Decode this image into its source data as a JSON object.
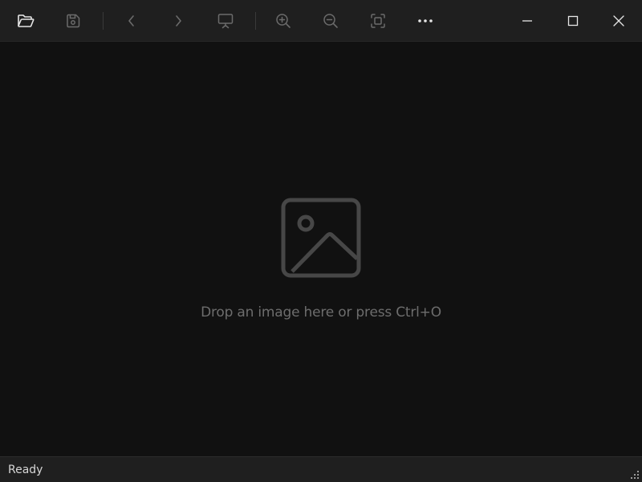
{
  "toolbar": {
    "buttons": [
      {
        "name": "open",
        "icon": "folder-open-icon"
      },
      {
        "name": "save",
        "icon": "save-icon"
      },
      {
        "name": "previous",
        "icon": "chevron-left-icon"
      },
      {
        "name": "next",
        "icon": "chevron-right-icon"
      },
      {
        "name": "slideshow",
        "icon": "slideshow-icon"
      },
      {
        "name": "zoom-in",
        "icon": "zoom-in-icon"
      },
      {
        "name": "zoom-out",
        "icon": "zoom-out-icon"
      },
      {
        "name": "fit-to-window",
        "icon": "fit-screen-icon"
      },
      {
        "name": "more",
        "icon": "more-icon"
      }
    ],
    "window_controls": [
      {
        "name": "minimize",
        "icon": "minimize-icon"
      },
      {
        "name": "maximize",
        "icon": "maximize-icon"
      },
      {
        "name": "close",
        "icon": "close-icon"
      }
    ]
  },
  "content": {
    "placeholder_icon": "image-placeholder-icon",
    "placeholder_text": "Drop an image here or press Ctrl+O"
  },
  "status": {
    "text": "Ready"
  },
  "colors": {
    "background": "#111111",
    "toolbar": "#1f1f1f",
    "icon_active": "#e6e6e6",
    "icon_disabled": "#6b6b6b",
    "placeholder": "#474747",
    "placeholder_text": "#6d6d6d"
  }
}
